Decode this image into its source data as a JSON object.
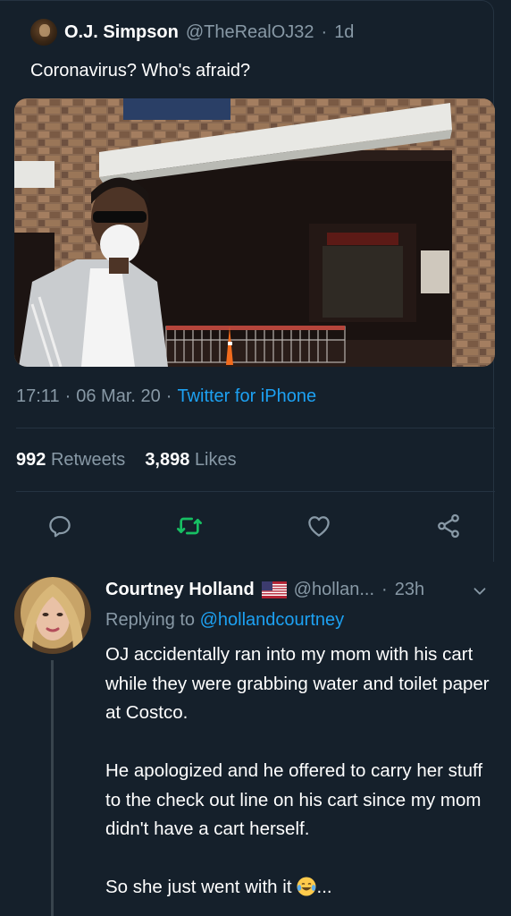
{
  "tweet": {
    "author_name": "O.J. Simpson",
    "author_handle": "@TheRealOJ32",
    "separator": "·",
    "age": "1d",
    "text": "Coronavirus? Who's afraid?",
    "time": "17:11",
    "date": "06 Mar. 20",
    "source": "Twitter for iPhone",
    "retweets_count": "992",
    "retweets_label": "Retweets",
    "likes_count": "3,898",
    "likes_label": "Likes",
    "icons": {
      "reply": "reply-icon",
      "retweet": "retweet-icon",
      "like": "heart-icon",
      "share": "share-icon"
    },
    "colors": {
      "retweet_accent": "#17bf63",
      "link": "#1da1f2",
      "muted": "#8899a6",
      "background": "#15202b"
    }
  },
  "reply": {
    "author_name": "Courtney Holland",
    "flag": "us-flag-emoji",
    "author_handle": "@hollan...",
    "separator": "·",
    "age": "23h",
    "replying_prefix": "Replying to",
    "replying_handle": "@hollandcourtney",
    "paragraphs": [
      "OJ accidentally ran into my mom with his cart while they were grabbing water and toilet paper at Costco.",
      "He apologized and he offered to carry her stuff to the check out line on his cart since my mom didn't have a cart herself.",
      "So she just went with it"
    ],
    "trailing_emoji": "tears-of-joy-emoji",
    "ellipsis": "..."
  }
}
